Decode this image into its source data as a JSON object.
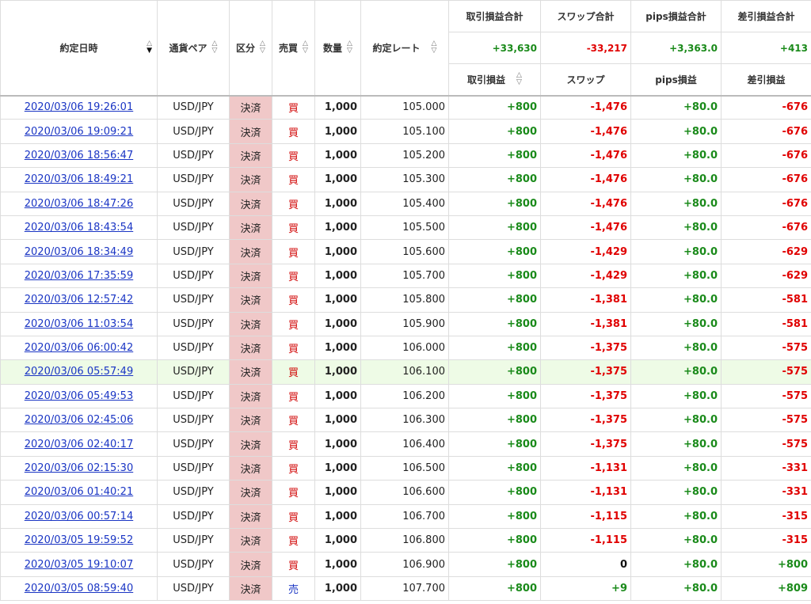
{
  "headers": {
    "date": "約定日時",
    "pair": "通貨ペア",
    "category": "区分",
    "side": "売買",
    "quantity": "数量",
    "rate": "約定レート",
    "pl_total": "取引損益合計",
    "swap_total": "スワップ合計",
    "pips_total": "pips損益合計",
    "net_total": "差引損益合計",
    "pl": "取引損益",
    "swap": "スワップ",
    "pips": "pips損益",
    "net": "差引損益"
  },
  "sort_icons": {
    "up": "△",
    "down": "▽",
    "down_active": "▼"
  },
  "totals": {
    "pl": "+33,630",
    "swap": "-33,217",
    "pips": "+3,363.0",
    "net": "+413"
  },
  "colors": {
    "positive": "#1a8a1a",
    "negative": "#e00000",
    "link": "#1a35c4",
    "category_bg": "#f0c8c8",
    "highlight_row": "#eefbe6"
  },
  "rows": [
    {
      "date": "2020/03/06 19:26:01",
      "pair": "USD/JPY",
      "category": "決済",
      "side": "買",
      "quantity": "1,000",
      "rate": "105.000",
      "pl": "+800",
      "swap": "-1,476",
      "pips": "+80.0",
      "net": "-676"
    },
    {
      "date": "2020/03/06 19:09:21",
      "pair": "USD/JPY",
      "category": "決済",
      "side": "買",
      "quantity": "1,000",
      "rate": "105.100",
      "pl": "+800",
      "swap": "-1,476",
      "pips": "+80.0",
      "net": "-676"
    },
    {
      "date": "2020/03/06 18:56:47",
      "pair": "USD/JPY",
      "category": "決済",
      "side": "買",
      "quantity": "1,000",
      "rate": "105.200",
      "pl": "+800",
      "swap": "-1,476",
      "pips": "+80.0",
      "net": "-676"
    },
    {
      "date": "2020/03/06 18:49:21",
      "pair": "USD/JPY",
      "category": "決済",
      "side": "買",
      "quantity": "1,000",
      "rate": "105.300",
      "pl": "+800",
      "swap": "-1,476",
      "pips": "+80.0",
      "net": "-676"
    },
    {
      "date": "2020/03/06 18:47:26",
      "pair": "USD/JPY",
      "category": "決済",
      "side": "買",
      "quantity": "1,000",
      "rate": "105.400",
      "pl": "+800",
      "swap": "-1,476",
      "pips": "+80.0",
      "net": "-676"
    },
    {
      "date": "2020/03/06 18:43:54",
      "pair": "USD/JPY",
      "category": "決済",
      "side": "買",
      "quantity": "1,000",
      "rate": "105.500",
      "pl": "+800",
      "swap": "-1,476",
      "pips": "+80.0",
      "net": "-676"
    },
    {
      "date": "2020/03/06 18:34:49",
      "pair": "USD/JPY",
      "category": "決済",
      "side": "買",
      "quantity": "1,000",
      "rate": "105.600",
      "pl": "+800",
      "swap": "-1,429",
      "pips": "+80.0",
      "net": "-629"
    },
    {
      "date": "2020/03/06 17:35:59",
      "pair": "USD/JPY",
      "category": "決済",
      "side": "買",
      "quantity": "1,000",
      "rate": "105.700",
      "pl": "+800",
      "swap": "-1,429",
      "pips": "+80.0",
      "net": "-629"
    },
    {
      "date": "2020/03/06 12:57:42",
      "pair": "USD/JPY",
      "category": "決済",
      "side": "買",
      "quantity": "1,000",
      "rate": "105.800",
      "pl": "+800",
      "swap": "-1,381",
      "pips": "+80.0",
      "net": "-581"
    },
    {
      "date": "2020/03/06 11:03:54",
      "pair": "USD/JPY",
      "category": "決済",
      "side": "買",
      "quantity": "1,000",
      "rate": "105.900",
      "pl": "+800",
      "swap": "-1,381",
      "pips": "+80.0",
      "net": "-581"
    },
    {
      "date": "2020/03/06 06:00:42",
      "pair": "USD/JPY",
      "category": "決済",
      "side": "買",
      "quantity": "1,000",
      "rate": "106.000",
      "pl": "+800",
      "swap": "-1,375",
      "pips": "+80.0",
      "net": "-575"
    },
    {
      "date": "2020/03/06 05:57:49",
      "pair": "USD/JPY",
      "category": "決済",
      "side": "買",
      "quantity": "1,000",
      "rate": "106.100",
      "pl": "+800",
      "swap": "-1,375",
      "pips": "+80.0",
      "net": "-575",
      "highlight": true
    },
    {
      "date": "2020/03/06 05:49:53",
      "pair": "USD/JPY",
      "category": "決済",
      "side": "買",
      "quantity": "1,000",
      "rate": "106.200",
      "pl": "+800",
      "swap": "-1,375",
      "pips": "+80.0",
      "net": "-575"
    },
    {
      "date": "2020/03/06 02:45:06",
      "pair": "USD/JPY",
      "category": "決済",
      "side": "買",
      "quantity": "1,000",
      "rate": "106.300",
      "pl": "+800",
      "swap": "-1,375",
      "pips": "+80.0",
      "net": "-575"
    },
    {
      "date": "2020/03/06 02:40:17",
      "pair": "USD/JPY",
      "category": "決済",
      "side": "買",
      "quantity": "1,000",
      "rate": "106.400",
      "pl": "+800",
      "swap": "-1,375",
      "pips": "+80.0",
      "net": "-575"
    },
    {
      "date": "2020/03/06 02:15:30",
      "pair": "USD/JPY",
      "category": "決済",
      "side": "買",
      "quantity": "1,000",
      "rate": "106.500",
      "pl": "+800",
      "swap": "-1,131",
      "pips": "+80.0",
      "net": "-331"
    },
    {
      "date": "2020/03/06 01:40:21",
      "pair": "USD/JPY",
      "category": "決済",
      "side": "買",
      "quantity": "1,000",
      "rate": "106.600",
      "pl": "+800",
      "swap": "-1,131",
      "pips": "+80.0",
      "net": "-331"
    },
    {
      "date": "2020/03/06 00:57:14",
      "pair": "USD/JPY",
      "category": "決済",
      "side": "買",
      "quantity": "1,000",
      "rate": "106.700",
      "pl": "+800",
      "swap": "-1,115",
      "pips": "+80.0",
      "net": "-315"
    },
    {
      "date": "2020/03/05 19:59:52",
      "pair": "USD/JPY",
      "category": "決済",
      "side": "買",
      "quantity": "1,000",
      "rate": "106.800",
      "pl": "+800",
      "swap": "-1,115",
      "pips": "+80.0",
      "net": "-315"
    },
    {
      "date": "2020/03/05 19:10:07",
      "pair": "USD/JPY",
      "category": "決済",
      "side": "買",
      "quantity": "1,000",
      "rate": "106.900",
      "pl": "+800",
      "swap": "0",
      "pips": "+80.0",
      "net": "+800"
    },
    {
      "date": "2020/03/05 08:59:40",
      "pair": "USD/JPY",
      "category": "決済",
      "side": "売",
      "quantity": "1,000",
      "rate": "107.700",
      "pl": "+800",
      "swap": "+9",
      "pips": "+80.0",
      "net": "+809"
    }
  ]
}
